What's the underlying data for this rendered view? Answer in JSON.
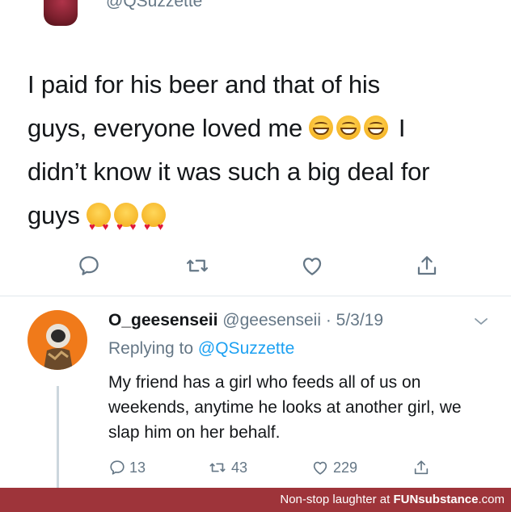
{
  "top": {
    "handle": "@QSuzzette"
  },
  "tweet": {
    "line1": "I paid for his beer and that of his",
    "line2a": "guys, everyone loved me",
    "line2b": "I",
    "line3": "didn’t know it was such a big deal for",
    "line4": "guys"
  },
  "reply": {
    "name": "O_geesenseii",
    "meta": "@geesenseii · 5/3/19",
    "replying_prefix": "Replying to",
    "replying_mention": "@QSuzzette",
    "text": "My friend has a girl who feeds all of us on weekends, anytime he looks at another girl, we slap him on her behalf.",
    "counts": {
      "replies": "13",
      "retweets": "43",
      "likes": "229"
    }
  },
  "banner": {
    "prefix": "Non-stop laughter at",
    "brand": "FUNsubstance",
    "suffix": ".com"
  },
  "colors": {
    "link": "#1da1f2",
    "muted": "#657786",
    "banner": "#9e343a"
  }
}
